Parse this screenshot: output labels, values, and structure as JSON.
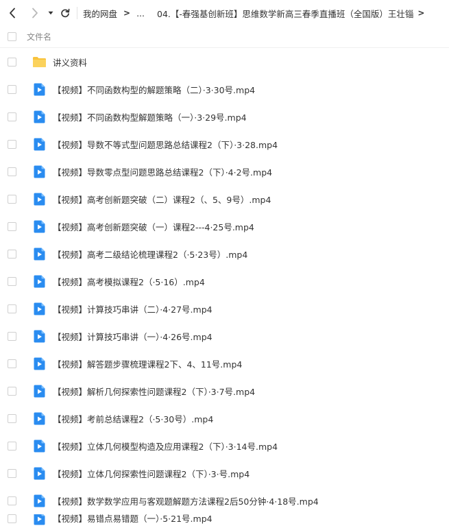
{
  "breadcrumb": {
    "root": "我的网盘",
    "ellipsis": "...",
    "current": "04.【-春强基创新班】思维数学新高三春季直播班（全国版）王壮锱"
  },
  "header": {
    "column_label": "文件名"
  },
  "icons": {
    "back": "chevron-left-icon",
    "forward": "chevron-right-icon",
    "history": "caret-down-icon",
    "refresh": "refresh-icon",
    "folder": "folder-icon",
    "video": "video-file-icon"
  },
  "colors": {
    "folder": "#f9c33c",
    "video": "#2a8cf0"
  },
  "files": [
    {
      "name": "讲义资料",
      "type": "folder"
    },
    {
      "name": "【视频】不同函数构型的解题策略（二）·3·30号.mp4",
      "type": "video"
    },
    {
      "name": "【视频】不同函数构型解题策略（一）·3·29号.mp4",
      "type": "video"
    },
    {
      "name": "【视频】导数不等式型问题思路总结课程2（下）·3·28.mp4",
      "type": "video"
    },
    {
      "name": "【视频】导数零点型问题思路总结课程2（下）·4·2号.mp4",
      "type": "video"
    },
    {
      "name": "【视频】高考创新题突破（二）课程2（、5、9号）.mp4",
      "type": "video"
    },
    {
      "name": "【视频】高考创新题突破（一）课程2---4·25号.mp4",
      "type": "video"
    },
    {
      "name": "【视频】高考二级结论梳理课程2（·5·23号）.mp4",
      "type": "video"
    },
    {
      "name": "【视频】高考模拟课程2（·5·16）.mp4",
      "type": "video"
    },
    {
      "name": "【视频】计算技巧串讲（二）·4·27号.mp4",
      "type": "video"
    },
    {
      "name": "【视频】计算技巧串讲（一）·4·26号.mp4",
      "type": "video"
    },
    {
      "name": "【视频】解答题步骤梳理课程2下、4、11号.mp4",
      "type": "video"
    },
    {
      "name": "【视频】解析几何探索性问题课程2（下）·3·7号.mp4",
      "type": "video"
    },
    {
      "name": "【视频】考前总结课程2（·5·30号）.mp4",
      "type": "video"
    },
    {
      "name": "【视频】立体几何模型构造及应用课程2（下）·3·14号.mp4",
      "type": "video"
    },
    {
      "name": "【视频】立体几何探索性问题课程2（下）·3·号.mp4",
      "type": "video"
    },
    {
      "name": "【视频】数学数学应用与客观题解题方法课程2后50分钟·4·18号.mp4",
      "type": "video"
    },
    {
      "name": "【视频】易错点易错题（一）·5·21号.mp4",
      "type": "video"
    }
  ]
}
